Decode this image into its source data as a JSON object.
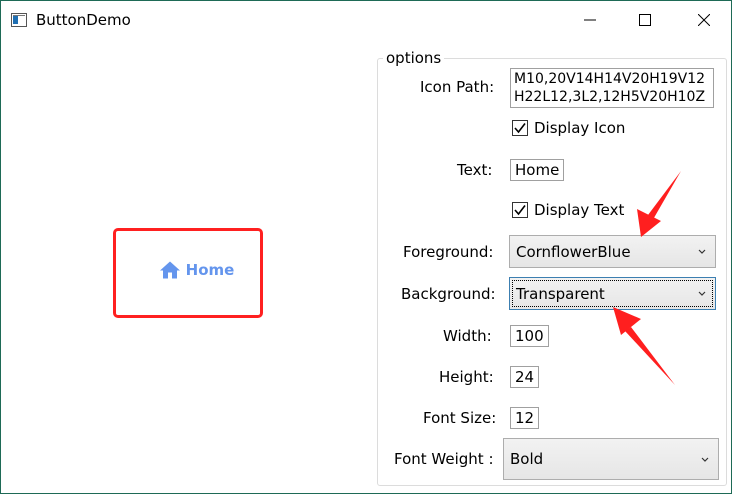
{
  "window": {
    "title": "ButtonDemo",
    "controls": [
      "minimize-icon",
      "maximize-icon",
      "close-icon"
    ]
  },
  "demo_button": {
    "icon": "home-icon",
    "text": "Home",
    "foreground": "#6495ed"
  },
  "options": {
    "legend": "options",
    "icon_path_label": "Icon Path:",
    "icon_path_line1": "M10,20V14H14V20H19V12",
    "icon_path_line2": "H22L12,3L2,12H5V20H10Z",
    "display_icon_label": "Display Icon",
    "display_icon_checked": true,
    "text_label": "Text:",
    "text_value": "Home",
    "display_text_label": "Display Text",
    "display_text_checked": true,
    "foreground_label": "Foreground:",
    "foreground_value": "CornflowerBlue",
    "background_label": "Background:",
    "background_value": "Transparent",
    "width_label": "Width:",
    "width_value": "100",
    "height_label": "Height:",
    "height_value": "24",
    "font_size_label": "Font Size:",
    "font_size_value": "12",
    "font_weight_label": "Font Weight :",
    "font_weight_value": "Bold"
  },
  "colors": {
    "highlight_red": "#ff2020",
    "accent_blue": "#6495ed",
    "window_border": "#1e6a56"
  }
}
